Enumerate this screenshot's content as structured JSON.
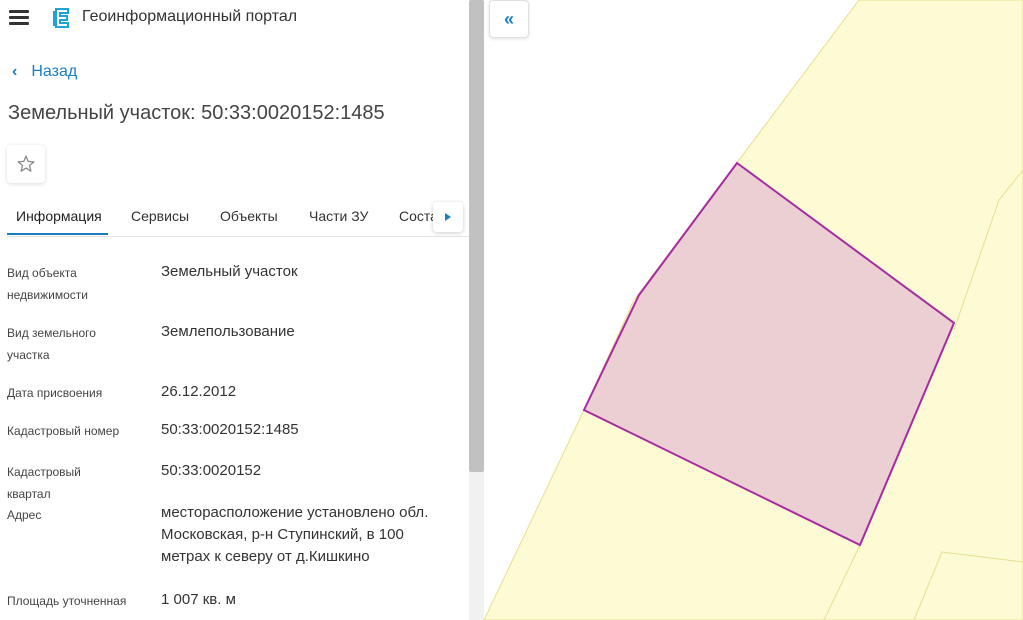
{
  "header": {
    "menu_icon": "hamburger-icon",
    "logo_icon": "portal-logo-icon",
    "title": "Геоинформационный портал"
  },
  "nav": {
    "back_label": "Назад"
  },
  "object": {
    "title": "Земельный участок: 50:33:0020152:1485"
  },
  "tabs": [
    {
      "label": "Информация",
      "active": true
    },
    {
      "label": "Сервисы"
    },
    {
      "label": "Объекты"
    },
    {
      "label": "Части ЗУ"
    },
    {
      "label": "Соста"
    }
  ],
  "properties": [
    {
      "label": "Вид объекта недвижимости",
      "value": "Земельный участок"
    },
    {
      "label": "Вид земельного участка",
      "value": "Землепользование"
    },
    {
      "label": "Дата присвоения",
      "value": "26.12.2012"
    },
    {
      "label": "Кадастровый номер",
      "value": "50:33:0020152:1485"
    },
    {
      "label": "Кадастровый квартал",
      "value": "50:33:0020152"
    },
    {
      "label": "Адрес",
      "value": "месторасположение установлено обл. Московская, р-н Ступинский, в 100 метрах к северу от д.Кишкино"
    },
    {
      "label": "Площадь уточненная",
      "value": "1 007 кв. м"
    }
  ],
  "colors": {
    "accent": "#1a7fc1",
    "map_zone_fill": "#fdfbd3",
    "map_zone_stroke": "#e6df8e",
    "parcel_fill": "#ebcfd2",
    "parcel_stroke": "#a62aa0"
  }
}
